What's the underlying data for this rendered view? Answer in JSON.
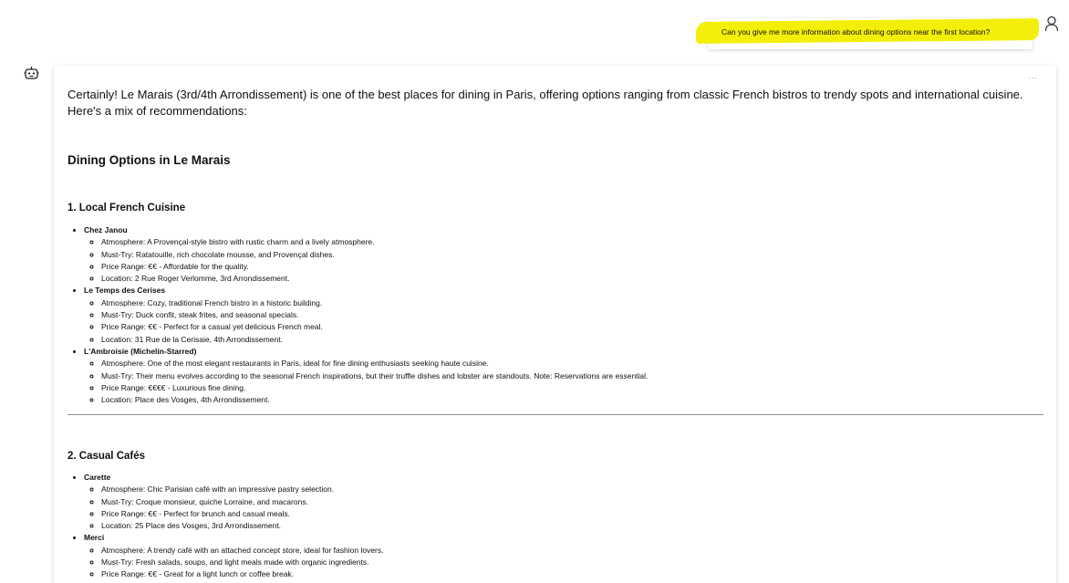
{
  "user_message": "Can you give me more information about dining options near the first location?",
  "icons": {
    "user": "user-avatar-icon",
    "bot": "bot-icon",
    "menu": "more-options-icon"
  },
  "colors": {
    "highlight": "#f4ef0a"
  },
  "card_menu": "...",
  "intro": "Certainly! Le Marais (3rd/4th Arrondissement) is one of the best places for dining in Paris, offering options ranging from classic French bistros to trendy spots and international cuisine. Here's a mix of recommendations:",
  "heading": "Dining Options in Le Marais",
  "sections": [
    {
      "title": "1. Local French Cuisine",
      "items": [
        {
          "name": "Chez Janou",
          "details": [
            "Atmosphere: A Provençal-style bistro with rustic charm and a lively atmosphere.",
            "Must-Try: Ratatouille, rich chocolate mousse, and Provençal dishes.",
            "Price Range: €€ - Affordable for the quality.",
            "Location: 2 Rue Roger Verlomme, 3rd Arrondissement."
          ]
        },
        {
          "name": "Le Temps des Cerises",
          "details": [
            "Atmosphere: Cozy, traditional French bistro in a historic building.",
            "Must-Try: Duck confit, steak frites, and seasonal specials.",
            "Price Range: €€ - Perfect for a casual yet delicious French meal.",
            "Location: 31 Rue de la Cerisaie, 4th Arrondissement."
          ]
        },
        {
          "name": "L'Ambroisie (Michelin-Starred)",
          "details": [
            "Atmosphere: One of the most elegant restaurants in Paris, ideal for fine dining enthusiasts seeking haute cuisine.",
            "Must-Try: Their menu evolves according to the seasonal French inspirations, but their truffle dishes and lobster are standouts. Note: Reservations are essential.",
            "Price Range: €€€€ - Luxurious fine dining.",
            "Location: Place des Vosges, 4th Arrondissement."
          ]
        }
      ]
    },
    {
      "title": "2. Casual Cafés",
      "items": [
        {
          "name": "Carette",
          "details": [
            "Atmosphere: Chic Parisian café with an impressive pastry selection.",
            "Must-Try: Croque monsieur, quiche Lorraine, and macarons.",
            "Price Range: €€ - Perfect for brunch and casual meals.",
            "Location: 25 Place des Vosges, 3rd Arrondissement."
          ]
        },
        {
          "name": "Merci",
          "details": [
            "Atmosphere: A trendy café with an attached concept store, ideal for fashion lovers.",
            "Must-Try: Fresh salads, soups, and light meals made with organic ingredients.",
            "Price Range: €€ - Great for a light lunch or coffee break."
          ]
        }
      ]
    }
  ]
}
